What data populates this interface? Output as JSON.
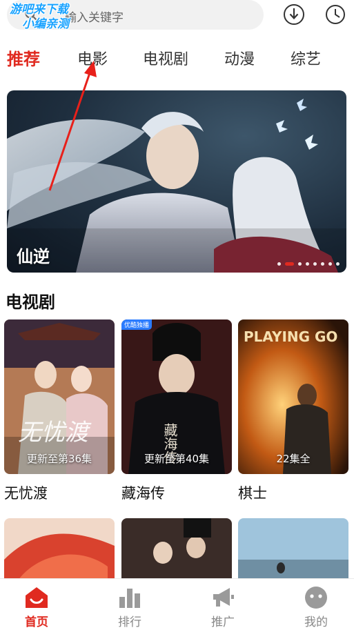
{
  "search": {
    "placeholder_text": "输入关键字",
    "watermark_line1": "游吧来下载",
    "watermark_line2": "小编亲测"
  },
  "header_icons": [
    "download-icon",
    "history-icon"
  ],
  "tabs": [
    {
      "label": "推荐",
      "active": true
    },
    {
      "label": "电影",
      "active": false
    },
    {
      "label": "电视剧",
      "active": false
    },
    {
      "label": "动漫",
      "active": false
    },
    {
      "label": "综艺",
      "active": false
    }
  ],
  "banner": {
    "title": "仙逆",
    "slide_count": 8,
    "active_slide": 2
  },
  "section": {
    "title": "电视剧",
    "items": [
      {
        "title": "无忧渡",
        "badge": "更新至第36集",
        "poster_text": "无忧渡"
      },
      {
        "title": "藏海传",
        "badge": "更新至第40集",
        "poster_text": "藏海传",
        "corner_tag": "优酷独播"
      },
      {
        "title": "棋士",
        "badge": "22集全",
        "poster_text": "PLAYING GO"
      }
    ]
  },
  "bottom_nav": [
    {
      "label": "首页",
      "icon": "home-icon",
      "active": true
    },
    {
      "label": "排行",
      "icon": "chart-icon",
      "active": false
    },
    {
      "label": "推广",
      "icon": "megaphone-icon",
      "active": false
    },
    {
      "label": "我的",
      "icon": "profile-icon",
      "active": false
    }
  ],
  "colors": {
    "accent": "#e02a20",
    "watermark": "#1aa3ff",
    "nav_inactive": "#888888"
  }
}
